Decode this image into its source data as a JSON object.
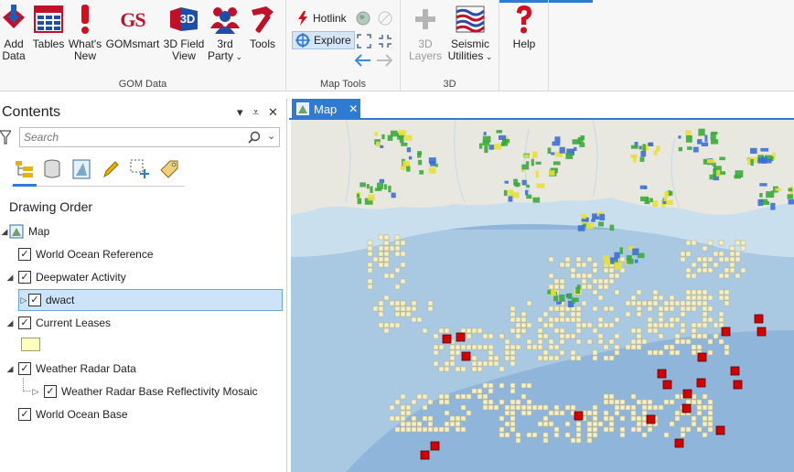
{
  "ribbon": {
    "groups": {
      "gom_data": "GOM Data",
      "map_tools": "Map Tools",
      "three_d": "3D"
    },
    "buttons": {
      "add_data": [
        "Add",
        "Data"
      ],
      "tables": "Tables",
      "whats_new": [
        "What's",
        "New"
      ],
      "gomsmart": "GOMsmart",
      "field_view": [
        "3D Field",
        "View"
      ],
      "third_party": [
        "3rd",
        "Party"
      ],
      "tools": "Tools",
      "hotlink": "Hotlink",
      "explore": "Explore",
      "three_d_layers": [
        "3D",
        "Layers"
      ],
      "seismic_utilities": [
        "Seismic",
        "Utilities"
      ],
      "help": "Help"
    },
    "icon_text": {
      "gomsmart": "GS",
      "field_view": "3D"
    }
  },
  "contents": {
    "title": "Contents",
    "pin_glyph": "⩡",
    "menu_glyph": "▾",
    "close_glyph": "✕",
    "search_placeholder": "Search",
    "drawing_order": "Drawing Order",
    "tree": [
      {
        "label": "Map"
      },
      {
        "label": "World Ocean Reference",
        "checked": true
      },
      {
        "label": "Deepwater Activity",
        "checked": true
      },
      {
        "label": "dwact",
        "checked": true,
        "selected": true
      },
      {
        "label": "Current Leases",
        "checked": true
      },
      {
        "label": "Weather Radar Data",
        "checked": true
      },
      {
        "label": "Weather Radar Base Reflectivity Mosaic",
        "checked": true
      },
      {
        "label": "World Ocean Base",
        "checked": true
      }
    ],
    "lease_swatch_color": "#ffffbe"
  },
  "map": {
    "tab_label": "Map",
    "colors": {
      "land": "#e8e7e0",
      "shelf": "#c9dfee",
      "slope": "#a9c9e3",
      "deep": "#8fb6da",
      "lease_fill": "#f3efc8",
      "lease_stroke": "#b9b38a",
      "activity": "#d40000",
      "radar_green": "#3daa3d",
      "radar_yellow": "#e8e03a",
      "radar_blue": "#3c6fd6"
    }
  }
}
